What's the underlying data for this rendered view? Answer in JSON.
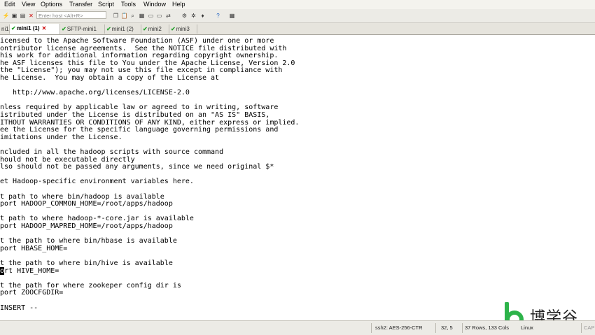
{
  "menu": {
    "items": [
      "Edit",
      "View",
      "Options",
      "Transfer",
      "Script",
      "Tools",
      "Window",
      "Help"
    ]
  },
  "toolbar": {
    "host_placeholder": "Enter host <Alt+R>"
  },
  "tabs": [
    {
      "label": "ni1",
      "status": "connected"
    },
    {
      "label": "mini1 (1)",
      "status": "connected",
      "active": true
    },
    {
      "label": "SFTP-mini1",
      "status": "connected"
    },
    {
      "label": "mini1 (2)",
      "status": "connected"
    },
    {
      "label": "mini2",
      "status": "connected"
    },
    {
      "label": "mini3",
      "status": "connected"
    }
  ],
  "terminal": {
    "lines": [
      "icensed to the Apache Software Foundation (ASF) under one or more",
      "ontributor license agreements.  See the NOTICE file distributed with",
      "his work for additional information regarding copyright ownership.",
      "he ASF licenses this file to You under the Apache License, Version 2.0",
      "the \"License\"); you may not use this file except in compliance with",
      "he License.  You may obtain a copy of the License at",
      "",
      "   http://www.apache.org/licenses/LICENSE-2.0",
      "",
      "nless required by applicable law or agreed to in writing, software",
      "istributed under the License is distributed on an \"AS IS\" BASIS,",
      "ITHOUT WARRANTIES OR CONDITIONS OF ANY KIND, either express or implied.",
      "ee the License for the specific language governing permissions and",
      "imitations under the License.",
      "",
      "ncluded in all the hadoop scripts with source command",
      "hould not be executable directly",
      "lso should not be passed any arguments, since we need original $*",
      "",
      "et Hadoop-specific environment variables here.",
      "",
      "t path to where bin/hadoop is available",
      "port HADOOP_COMMON_HOME=/root/apps/hadoop",
      "",
      "t path to where hadoop-*-core.jar is available",
      "port HADOOP_MAPRED_HOME=/root/apps/hadoop",
      "",
      "t the path to where bin/hbase is available",
      "port HBASE_HOME=",
      "",
      "t the path to where bin/hive is available",
      "",
      "",
      "t the path for where zookeper config dir is",
      "port ZOOCFGDIR=",
      "",
      "INSERT --"
    ],
    "cursor_line": {
      "cursor_char": "o",
      "rest": "rt HIVE_HOME="
    }
  },
  "status": {
    "cipher": "ssh2: AES-256-CTR",
    "position": "32,  5",
    "size": "37 Rows, 133 Cols",
    "os": "Linux",
    "caps": "CAP"
  },
  "watermark": {
    "text": "博学谷",
    "color": "#2db34a"
  }
}
